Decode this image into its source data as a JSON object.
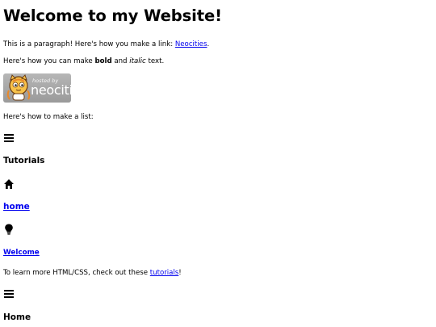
{
  "page": {
    "title": "Welcome to my Website!",
    "intro": {
      "before": "This is a paragraph! Here's how you make a link: ",
      "link_text": "Neocities",
      "after": "."
    },
    "formatting": {
      "before": "Here's how you can make ",
      "bold": "bold",
      "middle": " and ",
      "italic": "italic",
      "after": " text."
    },
    "badge": {
      "hosted_by": "hosted by",
      "brand": "neocities"
    },
    "list_intro": "Here's how to make a list:",
    "icons": {
      "menu_1": "menu-icon",
      "home": "home-icon",
      "bulb": "lightbulb-icon",
      "menu_2": "menu-icon"
    },
    "tutorials_heading": "Tutorials",
    "home_link": "home",
    "welcome_link": "Welcome",
    "tutorials_line": {
      "before": "To learn more HTML/CSS, check out these ",
      "link_text": "tutorials",
      "after": "!"
    },
    "home_heading": "Home"
  },
  "colors": {
    "link": "#0000ee",
    "text": "#000000",
    "badge_bg": "#a8a8a8",
    "badge_text": "#ffffff"
  }
}
